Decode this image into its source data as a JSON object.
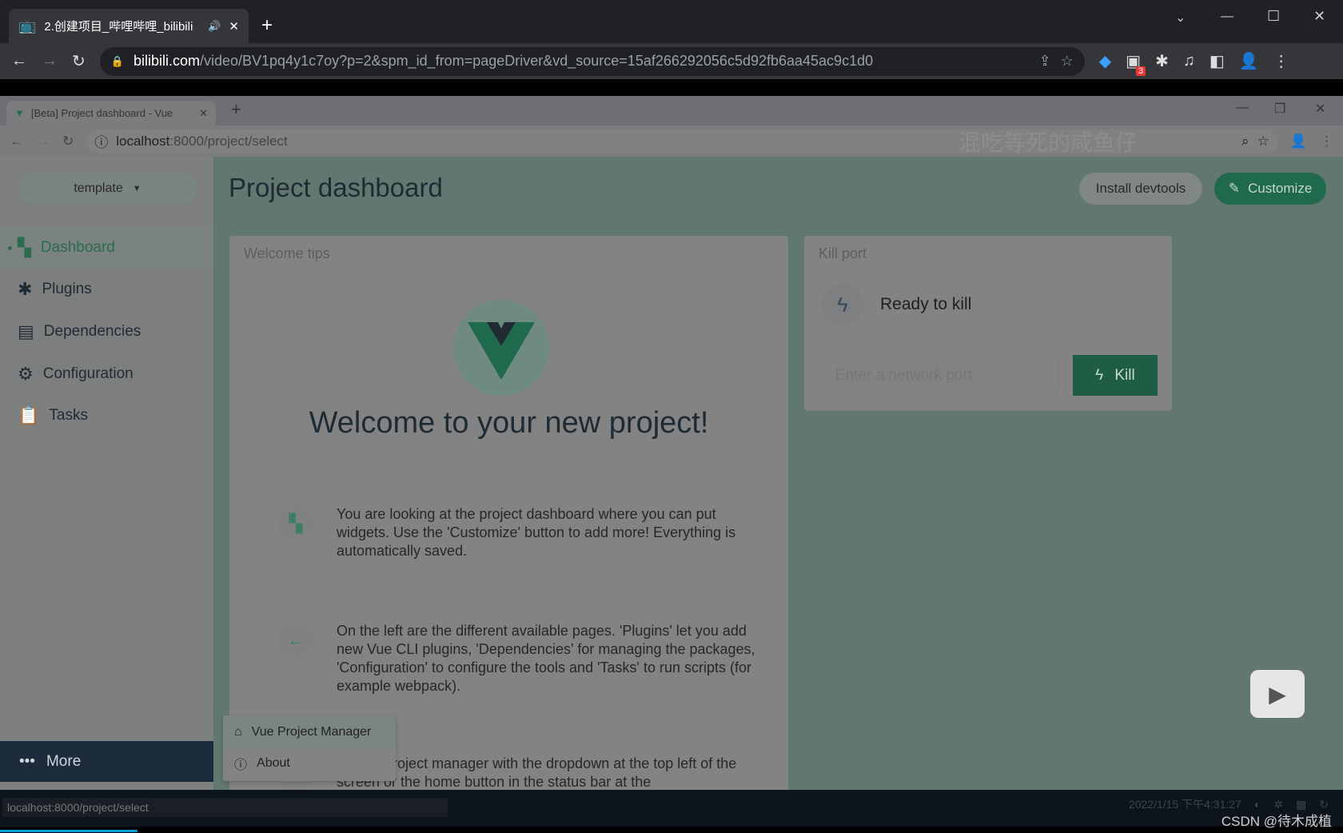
{
  "outer_browser": {
    "tab_title": "2.创建项目_哔哩哔哩_bilibili",
    "url_host": "bilibili.com",
    "url_path": "/video/BV1pq4y1c7oy?p=2&spm_id_from=pageDriver&vd_source=15af266292056c5d92fb6aa45ac9c1d0",
    "extension_badge": "3"
  },
  "inner_browser": {
    "tab_title": "[Beta] Project dashboard - Vue",
    "url_host": "localhost",
    "url_path": ":8000/project/select",
    "watermark": "混吃等死的咸鱼仔"
  },
  "sidebar": {
    "project": "template",
    "items": [
      {
        "label": "Dashboard",
        "icon": "dashboard-icon",
        "active": true
      },
      {
        "label": "Plugins",
        "icon": "puzzle-icon"
      },
      {
        "label": "Dependencies",
        "icon": "books-icon"
      },
      {
        "label": "Configuration",
        "icon": "settings-icon"
      },
      {
        "label": "Tasks",
        "icon": "clipboard-icon"
      }
    ],
    "more_label": "More"
  },
  "header": {
    "title": "Project dashboard",
    "install_devtools": "Install devtools",
    "customize": "Customize"
  },
  "welcome": {
    "title": "Welcome tips",
    "heading": "Welcome to your new project!",
    "tips": [
      "You are looking at the project dashboard where you can put widgets. Use the 'Customize' button to add more! Everything is automatically saved.",
      "On the left are the different available pages. 'Plugins' let you add new Vue CLI plugins, 'Dependencies' for managing the packages, 'Configuration' to configure the tools and 'Tasks' to run scripts (for example webpack).",
      "...o the project manager with the dropdown at the top left of the screen or the home button in the status bar at the"
    ]
  },
  "kill_port": {
    "title": "Kill port",
    "status": "Ready to kill",
    "placeholder": "Enter a network port",
    "button": "Kill"
  },
  "more_menu": {
    "items": [
      {
        "label": "Vue Project Manager",
        "icon": "home-icon"
      },
      {
        "label": "About",
        "icon": "info-icon"
      }
    ]
  },
  "status_bar": {
    "hover_url": "localhost:8000/project/select",
    "datetime": "2022/1/15 下午4:31:27"
  },
  "overlay_watermark": "CSDN @待木成植",
  "colors": {
    "vue_green": "#42b883",
    "accent_dimmed": "#1f6a4d",
    "bilibili_blue": "#00a1d6"
  }
}
